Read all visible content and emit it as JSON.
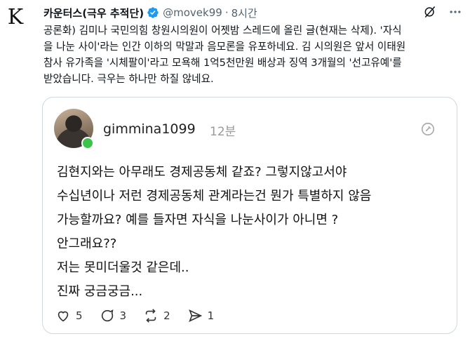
{
  "avatar_letter": "K",
  "author": {
    "name": "카운터스(극우 추적단)",
    "handle": "@movek99",
    "time": "8시간"
  },
  "tweet_text": "공론화) 김미나 국민의힘 창원시의원이 어젯밤 스레드에 올린 글(현재는 삭제). '자식\n을 나눈 사이'라는 인간 이하의 막말과 음모론을 유포하네요. 김 시의원은 앞서 이태원\n참사 유가족을 '시체팔이'라고 모욕해 1억5천만원 배상과 징역 3개월의 '선고유예'를\n받았습니다. 극우는 하나만 하질 않네요.",
  "thread_post": {
    "username": "gimmina1099",
    "time": "12분",
    "text": "김현지와는 아무래도 경제공동체 같죠? 그렇지않고서야\n수십년이나  저런 경제공동체 관계라는건 뭔가 특별하지 않음\n가능할까요? 예를 들자면 자식을 나눈사이가 아니면 ?\n안그래요??\n저는 못미더울것 같은데..\n진짜 궁금궁금...",
    "likes": "5",
    "comments": "3",
    "reposts": "2",
    "shares": "1"
  },
  "colors": {
    "verified": "#1d9bf0",
    "secondary": "#536471",
    "online": "#3bc34a"
  }
}
